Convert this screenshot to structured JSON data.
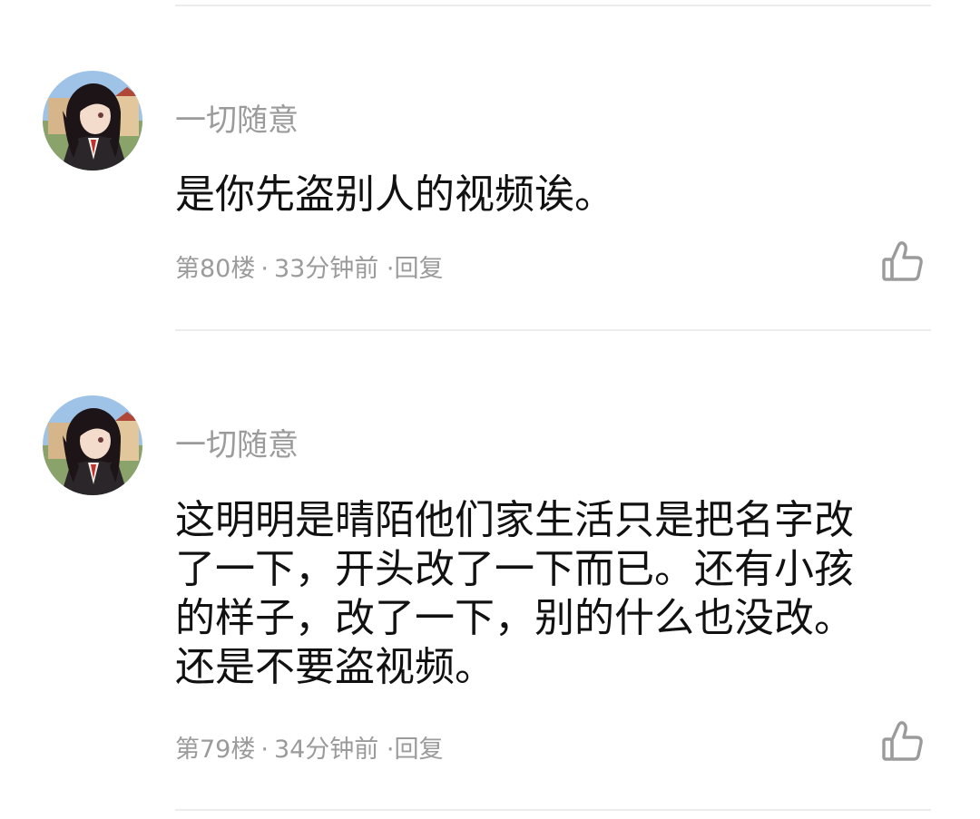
{
  "comments": [
    {
      "username": "一切随意",
      "text": "是你先盗别人的视频诶。",
      "floor": "第80楼",
      "dot": "·",
      "time": "33分钟前",
      "reply": "·回复",
      "like_icon": "thumbs-up-icon"
    },
    {
      "username": "一切随意",
      "text": "这明明是晴陌他们家生活只是把名字改了一下，开头改了一下而已。还有小孩的样子，改了一下，别的什么也没改。还是不要盗视频。",
      "floor": "第79楼",
      "dot": "·",
      "time": "34分钟前",
      "reply": "·回复",
      "like_icon": "thumbs-up-icon"
    }
  ],
  "colors": {
    "text_primary": "#111111",
    "text_secondary": "#9b9b9b",
    "divider": "#ececec"
  }
}
